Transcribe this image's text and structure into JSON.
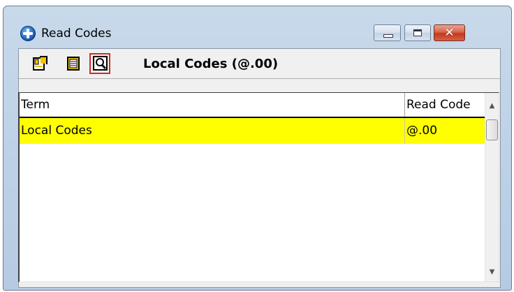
{
  "window": {
    "title": "Read Codes",
    "icon": "app-globe-icon",
    "controls": {
      "minimize": "minimize-icon",
      "maximize": "maximize-icon",
      "close_glyph": "✕"
    }
  },
  "toolbar": {
    "buttons": [
      {
        "name": "new-code-button",
        "icon": "new-document-icon"
      },
      {
        "name": "properties-button",
        "icon": "document-list-icon"
      },
      {
        "name": "search-button",
        "icon": "magnifier-icon",
        "active": true
      }
    ],
    "header_label": "Local Codes (@.00)"
  },
  "grid": {
    "columns": [
      "Term",
      "Read Code"
    ],
    "rows": [
      {
        "term": "Local Codes",
        "code": "@.00",
        "highlight": "#ffff00"
      }
    ],
    "scroll": {
      "up_glyph": "▲",
      "down_glyph": "▼"
    }
  },
  "colors": {
    "selection": "#ffff00",
    "active_tool_border": "#c83024",
    "close_button": "#c4391b"
  }
}
